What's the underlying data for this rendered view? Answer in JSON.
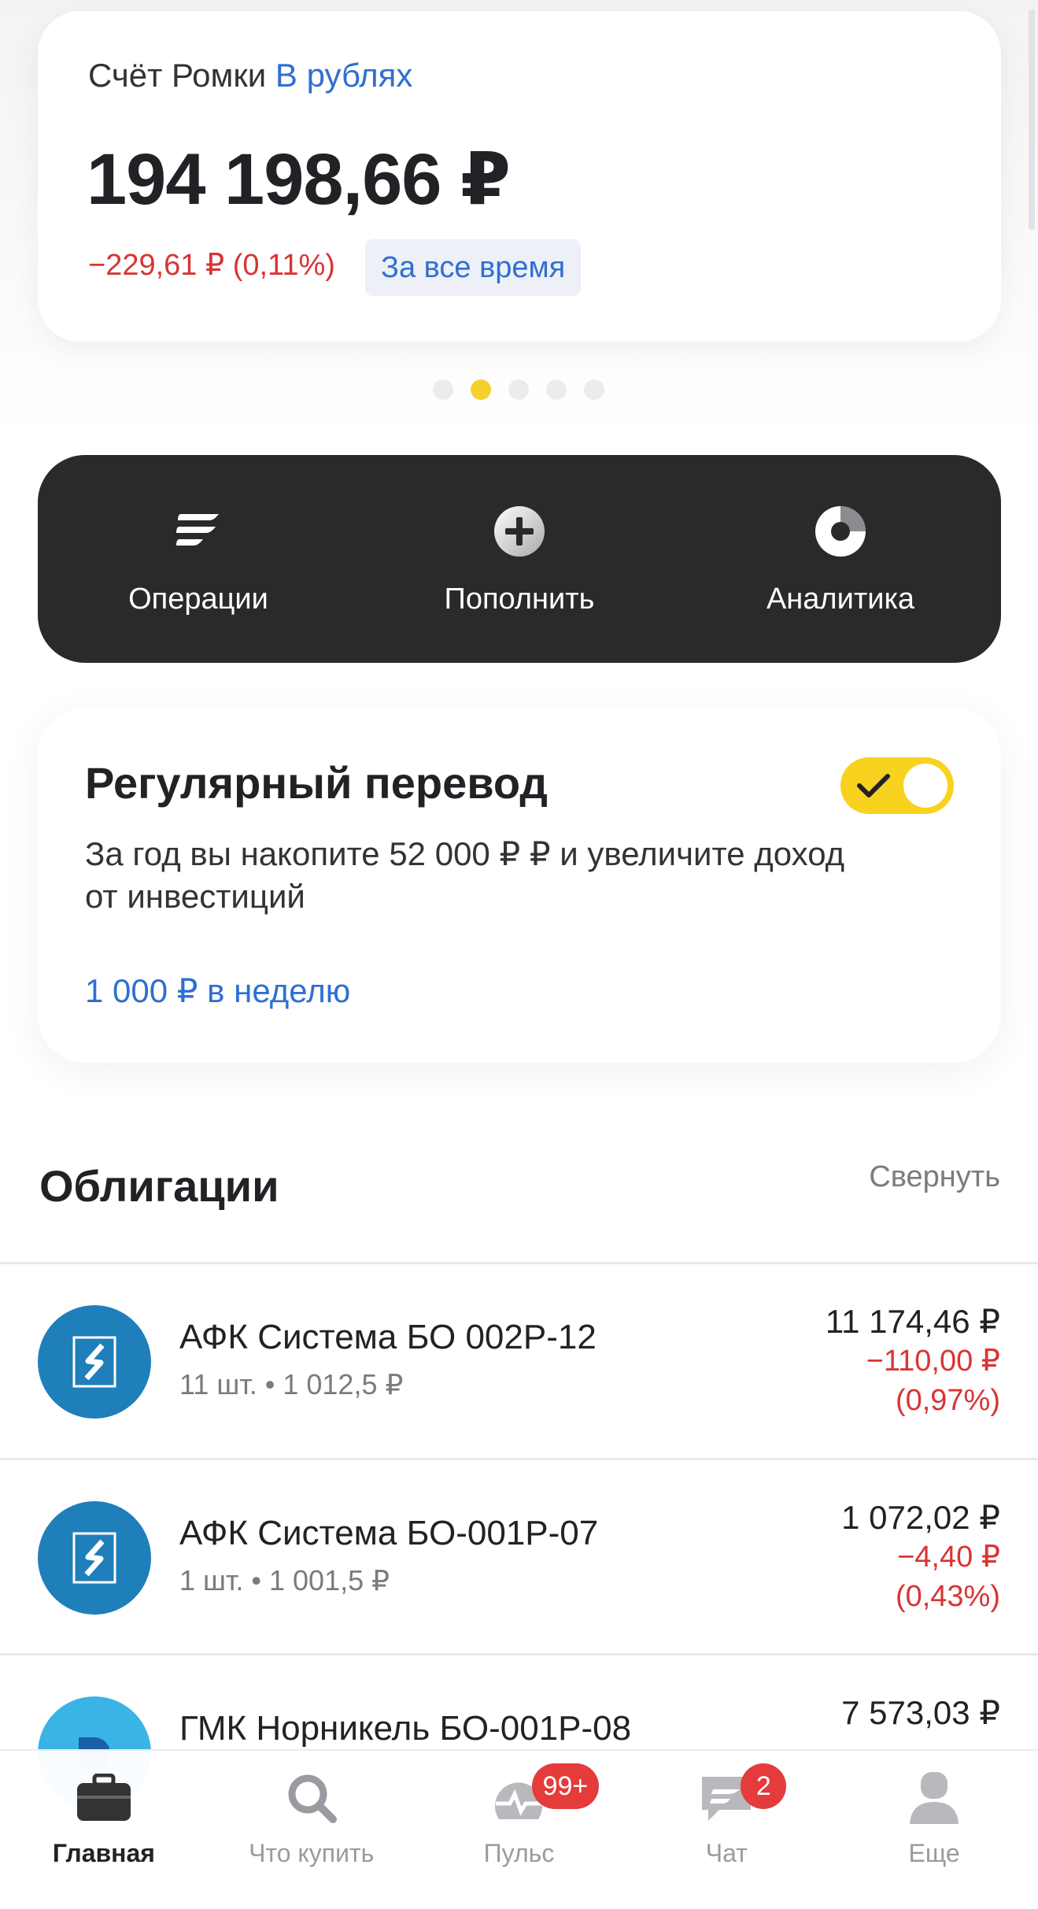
{
  "account": {
    "name": "Счёт Ромки",
    "currency_label": "В рублях",
    "balance": "194 198,66 ₽",
    "change": "−229,61 ₽ (0,11%)",
    "period_label": "За все время"
  },
  "carousel": {
    "total": 5,
    "active_index": 1
  },
  "actions": [
    {
      "label": "Операции",
      "icon": "operations-icon"
    },
    {
      "label": "Пополнить",
      "icon": "plus-circle-icon"
    },
    {
      "label": "Аналитика",
      "icon": "pie-chart-icon"
    }
  ],
  "regular_transfer": {
    "title": "Регулярный перевод",
    "description": "За год вы накопите 52 000 ₽ ₽ и увеличите доход от инвестиций",
    "amount": "1 000 ₽ в неделю",
    "enabled": true
  },
  "bonds": {
    "title": "Облигации",
    "collapse_label": "Свернуть",
    "items": [
      {
        "name": "АФК Система БО 002Р-12",
        "details": "11 шт. • 1 012,5 ₽",
        "value": "11 174,46 ₽",
        "delta": "−110,00 ₽",
        "delta_pct": "(0,97%)",
        "logo": "afk-sistema-logo"
      },
      {
        "name": "АФК Система БО-001Р-07",
        "details": "1 шт. • 1 001,5 ₽",
        "value": "1 072,02 ₽",
        "delta": "−4,40 ₽",
        "delta_pct": "(0,43%)",
        "logo": "afk-sistema-logo"
      },
      {
        "name": "ГМК Норникель БО-001Р-08",
        "details": "",
        "value": "7 573,03 ₽",
        "delta": "",
        "delta_pct": "",
        "logo": "nornickel-logo"
      }
    ]
  },
  "tabbar": [
    {
      "label": "Главная",
      "icon": "briefcase-icon",
      "active": true
    },
    {
      "label": "Что купить",
      "icon": "search-icon",
      "active": false
    },
    {
      "label": "Пульс",
      "icon": "pulse-icon",
      "badge": "99+",
      "active": false
    },
    {
      "label": "Чат",
      "icon": "chat-icon",
      "badge": "2",
      "active": false
    },
    {
      "label": "Еще",
      "icon": "profile-icon",
      "active": false
    }
  ],
  "colors": {
    "accent_yellow": "#f7d21f",
    "link_blue": "#2f6fd0",
    "negative_red": "#d93434",
    "dark_panel": "#2a2a2d"
  }
}
